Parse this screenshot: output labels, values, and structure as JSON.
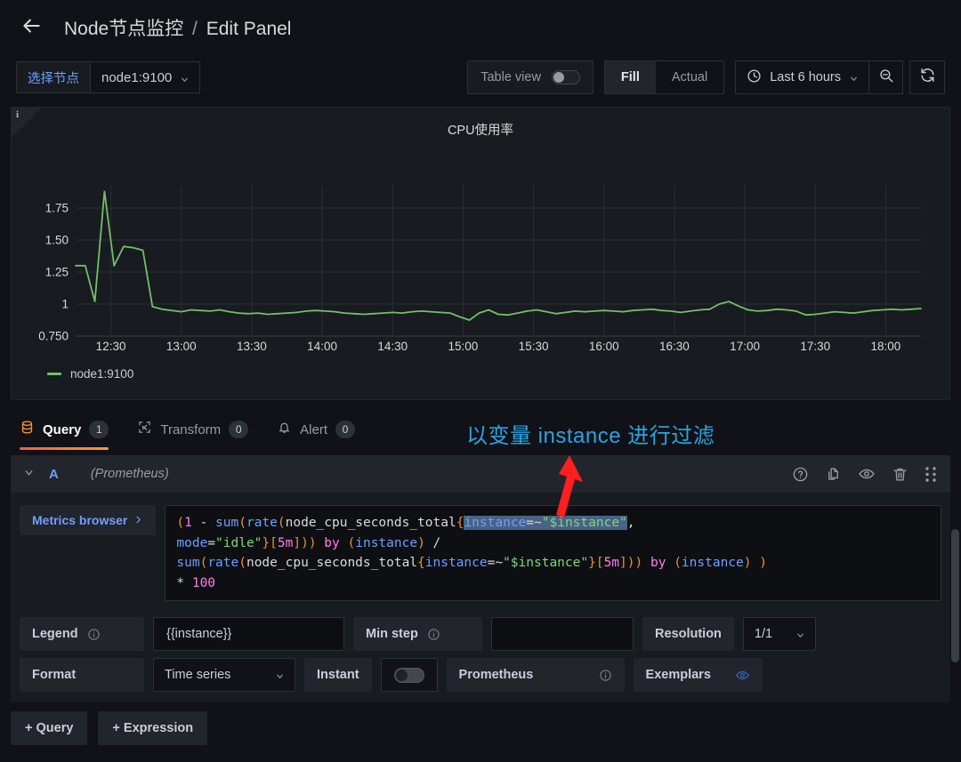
{
  "header": {
    "back_icon": "arrow-left-icon",
    "dashboard_title": "Node节点监控",
    "separator": "/",
    "page_title": "Edit Panel"
  },
  "toolbar": {
    "variable_label": "选择节点",
    "variable_value": "node1:9100",
    "table_view_label": "Table view",
    "table_view_on": false,
    "fill_label": "Fill",
    "actual_label": "Actual",
    "fill_active": true,
    "time_range": "Last 6 hours",
    "zoom_out_icon": "zoom-out-icon",
    "refresh_icon": "refresh-icon",
    "clock_icon": "clock-icon"
  },
  "panel": {
    "info_icon": "info-corner-icon",
    "title": "CPU使用率",
    "legend_label": "node1:9100",
    "legend_color": "#73bf69"
  },
  "chart_data": {
    "type": "line",
    "title": "CPU使用率",
    "xlabel": "",
    "ylabel": "",
    "grid": true,
    "legend_position": "bottom-left",
    "series": [
      {
        "name": "node1:9100",
        "color": "#73bf69",
        "values": [
          1.3,
          1.3,
          1.02,
          1.88,
          1.3,
          1.45,
          1.44,
          1.42,
          0.98,
          0.96,
          0.95,
          0.94,
          0.955,
          0.95,
          0.945,
          0.955,
          0.94,
          0.93,
          0.925,
          0.93,
          0.92,
          0.925,
          0.93,
          0.935,
          0.945,
          0.95,
          0.945,
          0.94,
          0.93,
          0.925,
          0.92,
          0.925,
          0.93,
          0.935,
          0.93,
          0.94,
          0.945,
          0.94,
          0.935,
          0.93,
          0.9,
          0.875,
          0.93,
          0.955,
          0.92,
          0.915,
          0.93,
          0.945,
          0.955,
          0.94,
          0.925,
          0.935,
          0.945,
          0.94,
          0.945,
          0.95,
          0.945,
          0.94,
          0.95,
          0.955,
          0.96,
          0.95,
          0.945,
          0.935,
          0.945,
          0.955,
          0.96,
          1.0,
          1.02,
          0.985,
          0.955,
          0.945,
          0.95,
          0.96,
          0.955,
          0.945,
          0.915,
          0.92,
          0.93,
          0.94,
          0.935,
          0.93,
          0.94,
          0.95,
          0.955,
          0.96,
          0.955,
          0.96,
          0.965
        ]
      }
    ],
    "yticks": [
      "1.75",
      "1.50",
      "1.25",
      "1",
      "0.750"
    ],
    "ylim": [
      0.75,
      1.875
    ],
    "xticks": [
      "12:30",
      "13:00",
      "13:30",
      "14:00",
      "14:30",
      "15:00",
      "15:30",
      "16:00",
      "16:30",
      "17:00",
      "17:30",
      "18:00"
    ]
  },
  "tabs": [
    {
      "label": "Query",
      "count": "1",
      "icon": "database-icon",
      "active": true
    },
    {
      "label": "Transform",
      "count": "0",
      "icon": "transform-icon",
      "active": false
    },
    {
      "label": "Alert",
      "count": "0",
      "icon": "bell-icon",
      "active": false
    }
  ],
  "annotation": {
    "text": "以变量 instance 进行过滤",
    "color": "#29a3e3",
    "arrow_color": "#ff1f1f"
  },
  "query": {
    "letter": "A",
    "datasource": "(Prometheus)",
    "collapse_icon": "chevron-down-icon",
    "actions": [
      "help-icon",
      "duplicate-icon",
      "eye-icon",
      "trash-icon",
      "drag-handle-icon"
    ],
    "metrics_browser_label": "Metrics browser",
    "expression_lines": [
      "(1 - sum(rate(node_cpu_seconds_total{instance=~\"$instance\",",
      "mode=\"idle\"}[5m])) by (instance) /",
      "sum(rate(node_cpu_seconds_total{instance=~\"$instance\"}[5m])) by (instance) )",
      "* 100"
    ],
    "selected_text": "instance=~\"$instance\"",
    "options": {
      "legend_label": "Legend",
      "legend_value": "{{instance}}",
      "min_step_label": "Min step",
      "min_step_value": "",
      "resolution_label": "Resolution",
      "resolution_value": "1/1",
      "format_label": "Format",
      "format_value": "Time series",
      "instant_label": "Instant",
      "instant_on": false,
      "prometheus_label": "Prometheus",
      "exemplars_label": "Exemplars"
    }
  },
  "footer": {
    "add_query_label": "+  Query",
    "add_expression_label": "+  Expression"
  }
}
